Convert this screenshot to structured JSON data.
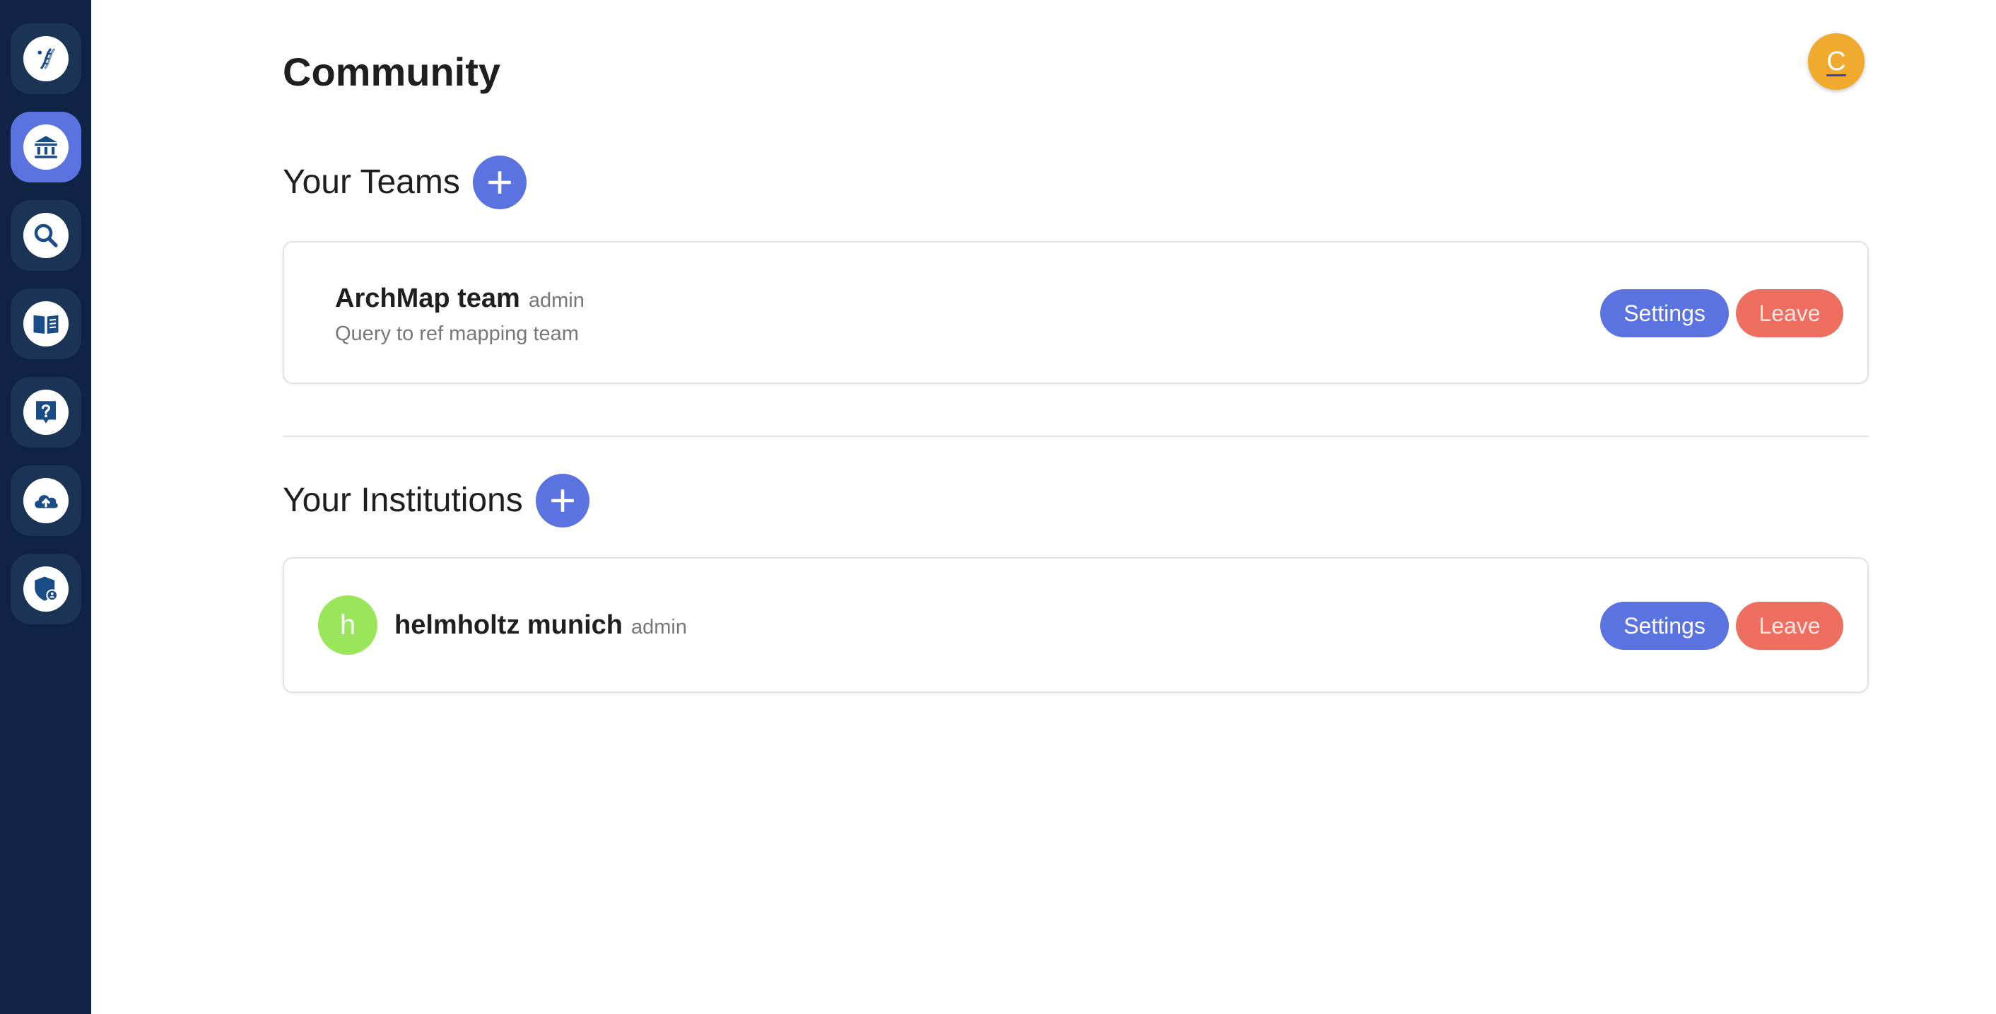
{
  "sidebar": {
    "items": [
      {
        "icon": "dna-icon",
        "active": false
      },
      {
        "icon": "institution-icon",
        "active": true
      },
      {
        "icon": "search-icon",
        "active": false
      },
      {
        "icon": "book-icon",
        "active": false
      },
      {
        "icon": "help-icon",
        "active": false
      },
      {
        "icon": "cloud-upload-icon",
        "active": false
      },
      {
        "icon": "shield-icon",
        "active": false
      }
    ]
  },
  "page": {
    "title": "Community",
    "user_initial": "C"
  },
  "teams": {
    "heading": "Your Teams",
    "items": [
      {
        "name": "ArchMap team",
        "role": "admin",
        "description": "Query to ref mapping team",
        "settings_label": "Settings",
        "leave_label": "Leave"
      }
    ]
  },
  "institutions": {
    "heading": "Your Institutions",
    "items": [
      {
        "initial": "h",
        "name": "helmholtz munich",
        "role": "admin",
        "settings_label": "Settings",
        "leave_label": "Leave"
      }
    ]
  },
  "colors": {
    "sidebar_bg": "#0f2444",
    "accent": "#5b73e0",
    "danger": "#ee6f60",
    "avatar": "#f0ab2e",
    "institution_avatar": "#9ae65a"
  }
}
